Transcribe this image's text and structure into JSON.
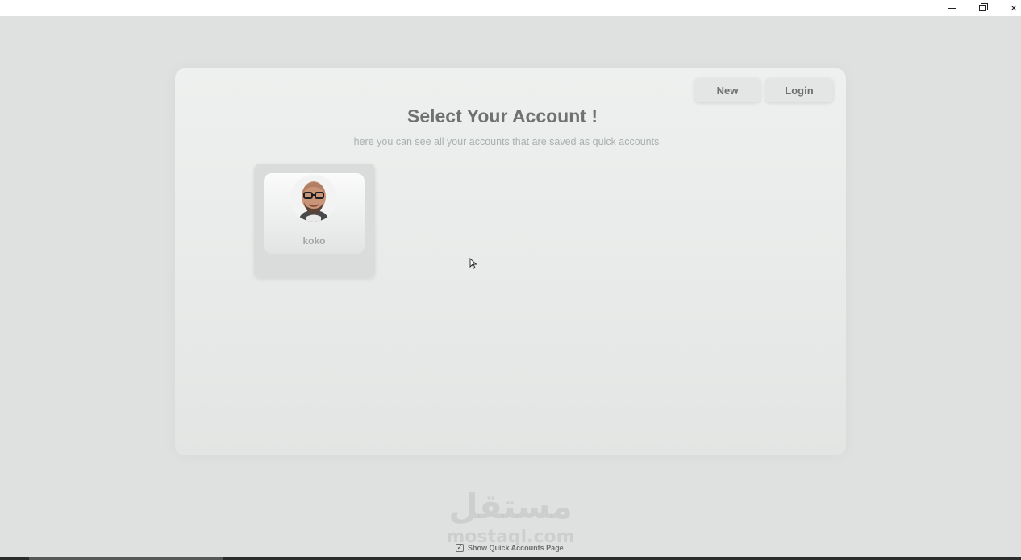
{
  "window": {
    "controls": {
      "minimize_icon": "minimize-icon",
      "maximize_icon": "restore-icon",
      "close_label": "✕"
    }
  },
  "header": {
    "new_label": "New",
    "login_label": "Login"
  },
  "main": {
    "title": "Select Your Account !",
    "subtitle": "here you can see all your accounts that are saved as quick accounts",
    "accounts": [
      {
        "name": "koko"
      }
    ]
  },
  "footer": {
    "show_quick_label": "Show Quick Accounts Page",
    "show_quick_checked": true,
    "watermark_ar": "مستقل",
    "watermark_en": "mostaql.com"
  },
  "colors": {
    "background": "#dfe1e0",
    "panel": "#eef0ef",
    "text_dark": "#6f7270",
    "text_muted": "#aab0ad"
  }
}
